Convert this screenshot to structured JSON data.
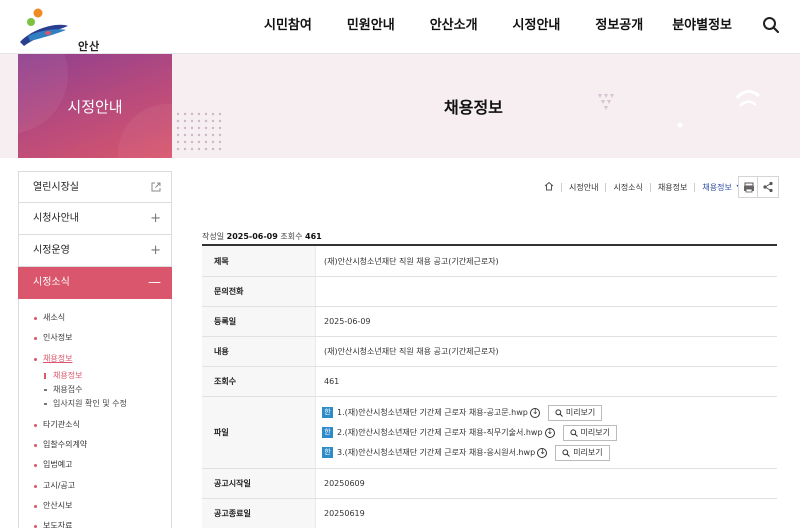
{
  "header": {
    "logo_text": "안산시",
    "nav": [
      "시민참여",
      "민원안내",
      "안산소개",
      "시정안내",
      "정보공개",
      "분야별정보"
    ]
  },
  "banner": {
    "section_title": "시정안내",
    "page_title": "채용정보"
  },
  "lnb": {
    "items": [
      {
        "label": "열린시장실",
        "icon": "external-link-icon"
      },
      {
        "label": "시청사안내",
        "icon": "plus-icon"
      },
      {
        "label": "시정운영",
        "icon": "plus-icon"
      },
      {
        "label": "시정소식",
        "icon": "minus-icon"
      }
    ],
    "sub_items": [
      "새소식",
      "인사정보",
      "채용정보",
      "타기관소식",
      "입찰수의계약",
      "입법예고",
      "고시/공고",
      "안산시보",
      "보도자료"
    ],
    "sub3_items": [
      "채용정보",
      "채용접수",
      "입사지원 확인 및 수정"
    ]
  },
  "breadcrumb": {
    "items": [
      "시정안내",
      "시정소식",
      "채용정보"
    ],
    "current": "채용정보"
  },
  "meta": {
    "date_label": "작성일",
    "date": "2025-06-09",
    "views_label": "조회수",
    "views": "461"
  },
  "table": {
    "rows": [
      {
        "label": "제목",
        "value": "(재)안산시청소년재단 직원 채용 공고(기간제근로자)"
      },
      {
        "label": "문의전화",
        "value": ""
      },
      {
        "label": "등록일",
        "value": "2025-06-09"
      },
      {
        "label": "내용",
        "value": "(재)안산시청소년재단 직원 채용 공고(기간제근로자)"
      },
      {
        "label": "조회수",
        "value": "461"
      }
    ],
    "file_label": "파일",
    "files": [
      "1.(재)안산시청소년재단 기간제 근로자 채용-공고문.hwp",
      "2.(재)안산시청소년재단 기간제 근로자 채용-직무기술서.hwp",
      "3.(재)안산시청소년재단 기간제 근로자 채용-응시원서.hwp"
    ],
    "preview_label": "미리보기",
    "hwp_badge": "한",
    "rows_after": [
      {
        "label": "공고시작일",
        "value": "20250609"
      },
      {
        "label": "공고종료일",
        "value": "20250619"
      }
    ]
  },
  "colors": {
    "accent": "#d9566c",
    "link": "#2d4fa3"
  }
}
